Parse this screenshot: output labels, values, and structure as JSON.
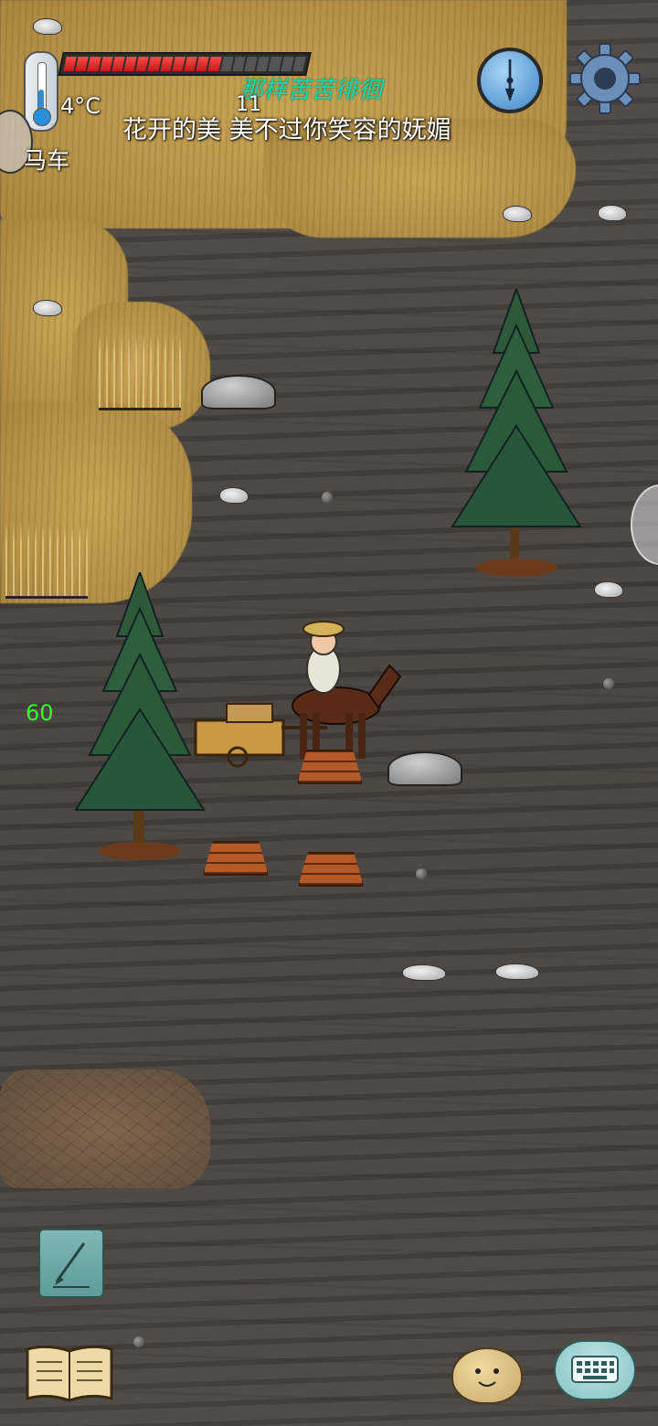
{
  "hud": {
    "temperature": "4°C",
    "food_pips_total": 20,
    "food_pips_filled": 13,
    "age": "11",
    "held_item": "马车",
    "fps": "60"
  },
  "lyrics": {
    "line1": "那样苦苦徘徊",
    "line2": "花开的美 美不过你笑容的妩媚"
  },
  "icons": {
    "thermometer": "thermometer-icon",
    "compass": "compass-icon",
    "settings": "gear-icon",
    "pen": "pen-icon",
    "book": "book-icon",
    "emote": "potato-face-icon",
    "keyboard": "keyboard-icon"
  },
  "colors": {
    "food": "#e02a2a",
    "lyric_top": "#19d6b0",
    "fps": "#33ff33"
  }
}
